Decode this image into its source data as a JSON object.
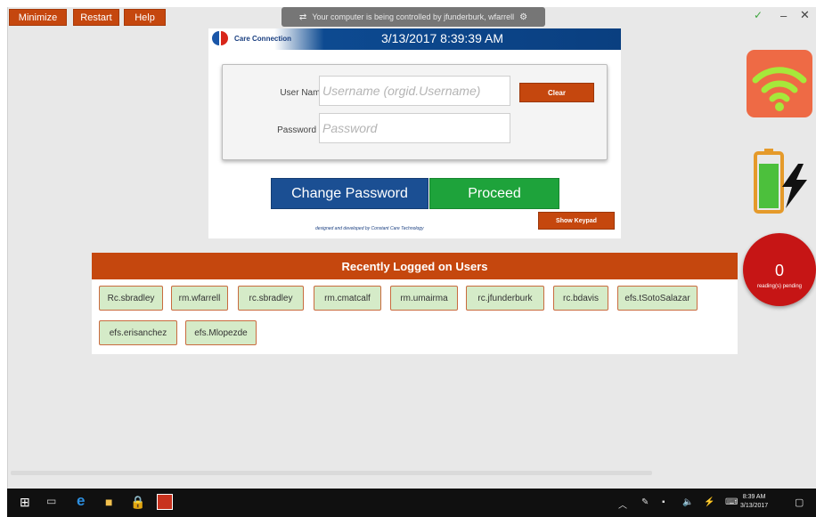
{
  "menu": {
    "minimize": "Minimize",
    "restart": "Restart",
    "help": "Help"
  },
  "remote_banner": {
    "icon": "remote-control-icon",
    "text": "Your computer is being controlled by jfunderburk, wfarrell",
    "menu_icon": "settings-icon"
  },
  "window_controls": {
    "check": "✓",
    "minimize": "–",
    "close": "✕"
  },
  "login": {
    "brand": "Care Connection",
    "datetime": "3/13/2017 8:39:39 AM",
    "username_label": "User Name",
    "username_placeholder": "Username (orgid.Username)",
    "password_label": "Password",
    "password_placeholder": "Password",
    "clear_label": "Clear",
    "change_password_label": "Change Password",
    "proceed_label": "Proceed",
    "show_keypad_label": "Show Keypad",
    "credit": "designed and developed by Constant Care Technology",
    "colors": {
      "header_blue": "#0d4a91",
      "accent_orange": "#c5470e",
      "proceed_green": "#1ea33b",
      "change_blue": "#1b4f93"
    }
  },
  "status": {
    "wifi_icon": "wifi-icon",
    "battery_icon": "battery-charging-icon",
    "battery_level": "85%",
    "pending_count": "0",
    "pending_label": "reading(s) pending"
  },
  "recent": {
    "title": "Recently Logged on Users",
    "users": [
      "Rc.sbradley",
      "rm.wfarrell",
      "rc.sbradley",
      "rm.cmatcalf",
      "rm.umairma",
      "rc.jfunderburk",
      "rc.bdavis",
      "efs.tSotoSalazar",
      "efs.erisanchez",
      "efs.Mlopezde"
    ]
  },
  "taskbar": {
    "icons": [
      "windows-start-icon",
      "task-view-icon",
      "edge-icon",
      "file-explorer-icon",
      "store-icon",
      "care-connection-app-icon"
    ],
    "time": "8:39 AM",
    "date": "3/13/2017"
  }
}
